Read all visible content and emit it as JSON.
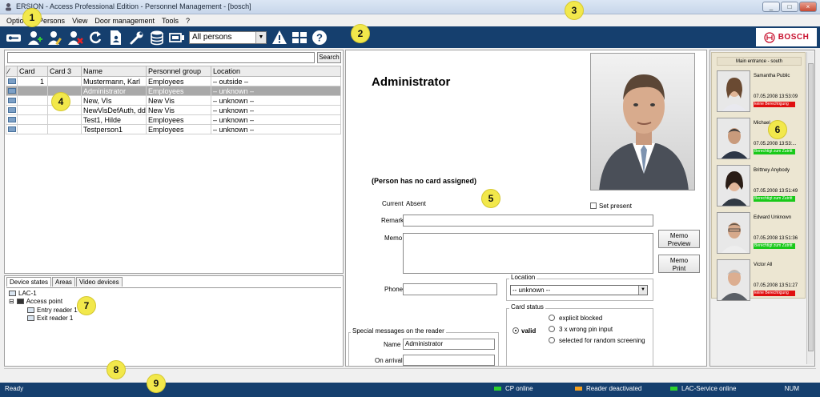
{
  "window": {
    "title": "Optiperson ERSION - Access Professional Edition - Personnel Management - [bosch]",
    "title_display": "ERSION - Access Professional Edition - Personnel Management - [bosch]",
    "minimize": "_",
    "maximize": "□",
    "close": "×"
  },
  "menu": [
    "Options",
    "Persons",
    "View",
    "Door management",
    "Tools",
    "?"
  ],
  "toolbar": {
    "filter_value": "All persons",
    "brand": "BOSCH",
    "icons": [
      "key-icon",
      "add-person-icon",
      "edit-person-icon",
      "delete-person-icon",
      "refresh-icon",
      "document-person-icon",
      "wrench-icon",
      "database-icon",
      "card-reader-icon",
      "warning-icon",
      "grid-icon",
      "help-icon"
    ]
  },
  "search": {
    "button": "Search",
    "value": ""
  },
  "persons": {
    "columns": [
      "",
      "Card",
      "Card 3",
      "Name",
      "Personnel group",
      "Location"
    ],
    "rows": [
      {
        "card": "1",
        "card3": "",
        "name": "Mustermann, Karl",
        "group": "Employees",
        "location": "– outside –",
        "selected": false
      },
      {
        "card": "",
        "card3": "",
        "name": "Administrator",
        "group": "Employees",
        "location": "– unknown –",
        "selected": true
      },
      {
        "card": "",
        "card3": "",
        "name": "New, VIs",
        "group": "New Vis",
        "location": "– unknown –",
        "selected": false
      },
      {
        "card": "",
        "card3": "",
        "name": "NewVisDefAuth, dd",
        "group": "New Vis",
        "location": "– unknown –",
        "selected": false
      },
      {
        "card": "",
        "card3": "",
        "name": "Test1, Hilde",
        "group": "Employees",
        "location": "– unknown –",
        "selected": false
      },
      {
        "card": "",
        "card3": "",
        "name": "Testperson1",
        "group": "Employees",
        "location": "– unknown –",
        "selected": false
      }
    ]
  },
  "device_tabs": [
    "Device states",
    "Areas",
    "Video devices"
  ],
  "device_tree": {
    "root": "LAC-1",
    "access_point": "Access point",
    "readers": [
      "Entry reader 1",
      "Exit reader 1"
    ]
  },
  "detail": {
    "name": "Administrator",
    "no_card": "(Person has no card assigned)",
    "current_label": "Current",
    "current_value": "Absent",
    "set_present": "Set present",
    "remark_label": "Remark",
    "memo_label": "Memo",
    "memo_preview": [
      "Memo",
      "Preview"
    ],
    "memo_print": [
      "Memo",
      "Print"
    ],
    "phone_label": "Phone",
    "location_group": "Location",
    "location_value": "-- unknown --",
    "card_status_group": "Card status",
    "valid_label": "valid",
    "card_status_options": [
      "explicit blocked",
      "3 x wrong pin input",
      "selected for random screening"
    ],
    "special_messages_group": "Special messages on the reader",
    "msg_name_label": "Name",
    "msg_name_value": "Administrator",
    "on_arrival_label": "On arrival"
  },
  "visitors": {
    "header": "Main entrance - south",
    "entries": [
      {
        "name": "Samantha Public",
        "time": "07.05.2008 13:53:09",
        "status": "keine Berechtigung",
        "status_color": "#e01010"
      },
      {
        "name": "Michael ...",
        "time": "07.05.2008 13:53:...",
        "status": "Berechtigt zum Zutritt",
        "status_color": "#19c919"
      },
      {
        "name": "Brittney Anybody",
        "time": "07.05.2008 13:51:49",
        "status": "Berechtigt zum Zutritt",
        "status_color": "#19c919"
      },
      {
        "name": "Edward Unknown",
        "time": "07.05.2008 13:51:36",
        "status": "Berechtigt zum Zutritt",
        "status_color": "#19c919"
      },
      {
        "name": "Victor All",
        "time": "07.05.2008 13:51:27",
        "status": "keine Berechtigung",
        "status_color": "#e01010"
      }
    ]
  },
  "status": {
    "ready": "Ready",
    "items": [
      {
        "label": "CP online",
        "color": "#2ed12e"
      },
      {
        "label": "Reader deactivated",
        "color": "#f3a020"
      },
      {
        "label": "LAC-Service online",
        "color": "#2ed12e"
      }
    ],
    "num": "NUM"
  },
  "callouts": [
    "1",
    "2",
    "3",
    "4",
    "5",
    "6",
    "7",
    "8",
    "9"
  ],
  "colors": {
    "toolbar_bg": "#153f6e",
    "selected_row": "#a9a9a9",
    "brand_red": "#c8102e"
  }
}
